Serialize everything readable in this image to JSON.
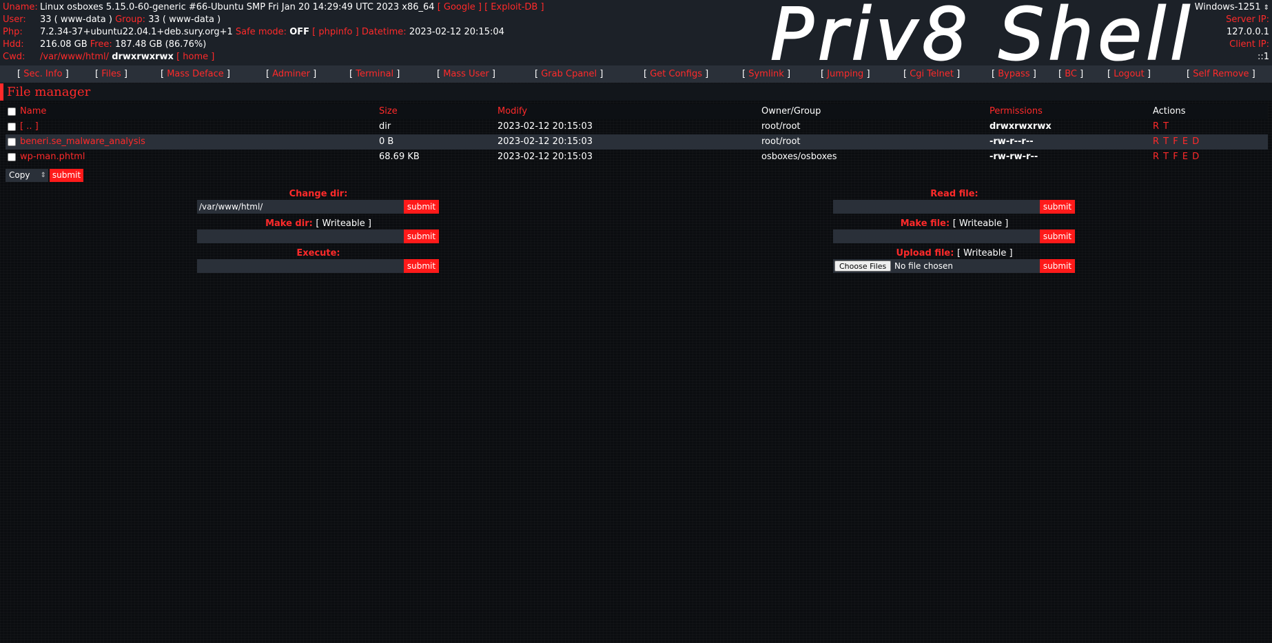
{
  "header": {
    "uname_label": "Uname:",
    "uname_value": "Linux osboxes 5.15.0-60-generic #66-Ubuntu SMP Fri Jan 20 14:29:49 UTC 2023 x86_64",
    "uname_link_google": "[ Google ]",
    "uname_link_exploitdb": "[ Exploit-DB ]",
    "user_label": "User:",
    "user_value": "33 ( www-data )",
    "group_label": "Group:",
    "group_value": "33 ( www-data )",
    "php_label": "Php:",
    "php_value": "7.2.34-37+ubuntu22.04.1+deb.sury.org+1",
    "safemode_label": "Safe mode:",
    "safemode_value": "OFF",
    "phpinfo_link": "[ phpinfo ]",
    "datetime_label": "Datetime:",
    "datetime_value": "2023-02-12 20:15:04",
    "hdd_label": "Hdd:",
    "hdd_value": "216.08 GB",
    "free_label": "Free:",
    "free_value": "187.48 GB (86.76%)",
    "cwd_label": "Cwd:",
    "cwd_path": "/var/www/html/",
    "cwd_perms": "drwxrwxrwx",
    "home_link": "[ home ]",
    "logo_text": "Priv8 Shell",
    "charset_value": "Windows-1251",
    "server_ip_label": "Server IP:",
    "server_ip_value": "127.0.0.1",
    "client_ip_label": "Client IP:",
    "client_ip_value": "::1"
  },
  "menu": {
    "items": [
      "Sec. Info",
      "Files",
      "Mass Deface",
      "Adminer",
      "Terminal",
      "Mass User",
      "Grab Cpanel",
      "Get Configs",
      "Symlink",
      "Jumping",
      "Cgi Telnet",
      "Bypass",
      "BC",
      "Logout",
      "Self Remove"
    ]
  },
  "file_manager": {
    "title": "File manager",
    "columns": {
      "name": "Name",
      "size": "Size",
      "modify": "Modify",
      "owner": "Owner/Group",
      "permissions": "Permissions",
      "actions": "Actions"
    },
    "rows": [
      {
        "name": "[ .. ]",
        "size": "dir",
        "modify": "2023-02-12 20:15:03",
        "owner": "root/root",
        "permissions": "drwxrwxrwx",
        "actions": "R T"
      },
      {
        "name": "beneri.se_malware_analysis",
        "size": "0 B",
        "modify": "2023-02-12 20:15:03",
        "owner": "root/root",
        "permissions": "-rw-r--r--",
        "actions": "R T F E D"
      },
      {
        "name": "wp-man.phtml",
        "size": "68.69 KB",
        "modify": "2023-02-12 20:15:03",
        "owner": "osboxes/osboxes",
        "permissions": "-rw-rw-r--",
        "actions": "R T F E D"
      }
    ],
    "action_select_value": "Copy",
    "submit_label": "submit"
  },
  "forms": {
    "change_dir_label": "Change dir:",
    "change_dir_value": "/var/www/html/",
    "make_dir_label": "Make dir:",
    "make_dir_status": "[ Writeable ]",
    "execute_label": "Execute:",
    "read_file_label": "Read file:",
    "make_file_label": "Make file:",
    "make_file_status": "[ Writeable ]",
    "upload_file_label": "Upload file:",
    "upload_file_status": "[ Writeable ]",
    "choose_files_label": "Choose Files",
    "no_file_text": "No file chosen",
    "submit_label": "submit"
  },
  "colors": {
    "accent": "#ff2a2a",
    "header_bg": "#1c2128",
    "menu_bg": "#2a3039",
    "page_bg": "#0b0d10"
  }
}
